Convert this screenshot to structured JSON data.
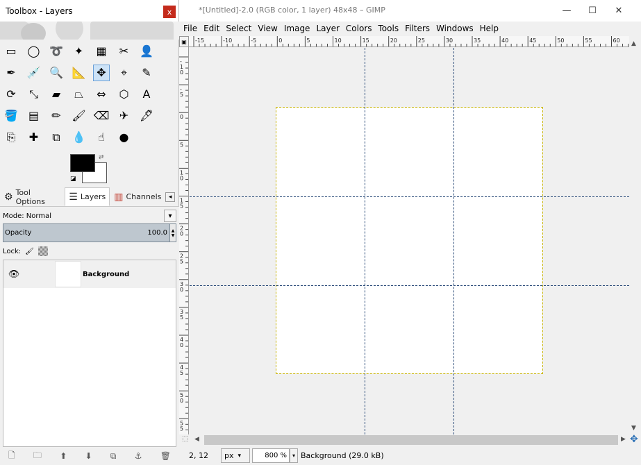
{
  "toolbox": {
    "title": "Toolbox - Layers",
    "close_glyph": "x",
    "tools": [
      {
        "name": "rect-select-icon",
        "glyph": "▭"
      },
      {
        "name": "ellipse-select-icon",
        "glyph": "◯"
      },
      {
        "name": "free-select-icon",
        "glyph": "➰"
      },
      {
        "name": "fuzzy-select-icon",
        "glyph": "✦"
      },
      {
        "name": "color-select-icon",
        "glyph": "▦"
      },
      {
        "name": "scissors-select-icon",
        "glyph": "✂"
      },
      {
        "name": "foreground-select-icon",
        "glyph": "👤"
      },
      {
        "name": "paths-icon",
        "glyph": "✒"
      },
      {
        "name": "color-picker-icon",
        "glyph": "💉"
      },
      {
        "name": "zoom-icon",
        "glyph": "🔍"
      },
      {
        "name": "measure-icon",
        "glyph": "📐"
      },
      {
        "name": "move-icon",
        "glyph": "✥"
      },
      {
        "name": "align-icon",
        "glyph": "⌖"
      },
      {
        "name": "crop-icon",
        "glyph": "✎"
      },
      {
        "name": "rotate-icon",
        "glyph": "⟳"
      },
      {
        "name": "scale-icon",
        "glyph": "⤡"
      },
      {
        "name": "shear-icon",
        "glyph": "▰"
      },
      {
        "name": "perspective-icon",
        "glyph": "⏢"
      },
      {
        "name": "flip-icon",
        "glyph": "⇔"
      },
      {
        "name": "cage-icon",
        "glyph": "⬡"
      },
      {
        "name": "text-icon",
        "glyph": "A"
      },
      {
        "name": "bucket-fill-icon",
        "glyph": "🪣"
      },
      {
        "name": "gradient-icon",
        "glyph": "▤"
      },
      {
        "name": "pencil-icon",
        "glyph": "✏"
      },
      {
        "name": "paintbrush-icon",
        "glyph": "🖌"
      },
      {
        "name": "eraser-icon",
        "glyph": "⌫"
      },
      {
        "name": "airbrush-icon",
        "glyph": "✈"
      },
      {
        "name": "ink-icon",
        "glyph": "🖋"
      },
      {
        "name": "clone-icon",
        "glyph": "⎘"
      },
      {
        "name": "heal-icon",
        "glyph": "✚"
      },
      {
        "name": "perspective-clone-icon",
        "glyph": "⧉"
      },
      {
        "name": "blur-icon",
        "glyph": "💧"
      },
      {
        "name": "smudge-icon",
        "glyph": "☝"
      },
      {
        "name": "dodge-burn-icon",
        "glyph": "●"
      }
    ],
    "tabs": [
      {
        "label": "Tool Options",
        "icon": "tool-options-icon",
        "glyph": "⚙"
      },
      {
        "label": "Layers",
        "icon": "layers-icon",
        "glyph": "☰"
      },
      {
        "label": "Channels",
        "icon": "channels-icon",
        "glyph": "▥"
      }
    ],
    "tab_menu_glyph": "◂",
    "mode_label": "Mode: Normal",
    "mode_dd_glyph": "▾",
    "opacity_label": "Opacity",
    "opacity_value": "100.0",
    "lock_label": "Lock:",
    "layers": [
      {
        "name": "Background",
        "visible_glyph": "👁"
      }
    ],
    "layer_buttons": [
      {
        "name": "new-layer-icon",
        "glyph": "🗋"
      },
      {
        "name": "layer-group-icon",
        "glyph": "🗀"
      },
      {
        "name": "raise-layer-icon",
        "glyph": "⬆"
      },
      {
        "name": "lower-layer-icon",
        "glyph": "⬇"
      },
      {
        "name": "duplicate-layer-icon",
        "glyph": "⧉"
      },
      {
        "name": "anchor-layer-icon",
        "glyph": "⚓"
      },
      {
        "name": "delete-layer-icon",
        "glyph": "🗑"
      }
    ]
  },
  "image_window": {
    "title": "*[Untitled]-2.0 (RGB color, 1 layer) 48x48 – GIMP",
    "minimize_glyph": "—",
    "maximize_glyph": "☐",
    "close_glyph": "✕",
    "menus": [
      "File",
      "Edit",
      "Select",
      "View",
      "Image",
      "Layer",
      "Colors",
      "Tools",
      "Filters",
      "Windows",
      "Help"
    ],
    "ruler_h_labels": [
      "-15",
      "-10",
      "-5",
      "0",
      "5",
      "10",
      "15",
      "20",
      "25",
      "30",
      "35",
      "40",
      "45",
      "50",
      "55",
      "60"
    ],
    "ruler_v_labels": [
      "-10",
      "-5",
      "0",
      "5",
      "10",
      "15",
      "20",
      "25",
      "30",
      "35",
      "40",
      "45",
      "50",
      "55"
    ],
    "corner_glyph": "▣",
    "scroll_up_glyph": "▲",
    "scroll_down_glyph": "▼",
    "scroll_left_glyph": "◀",
    "scroll_right_glyph": "▶",
    "navigate_glyph": "✥",
    "quickmask_glyph": "⬚",
    "status": {
      "coords": "2, 12",
      "unit": "px",
      "unit_dd_glyph": "▾",
      "zoom": "800 %",
      "zoom_dd_glyph": "▾",
      "message": "Background (29.0 kB)"
    }
  }
}
